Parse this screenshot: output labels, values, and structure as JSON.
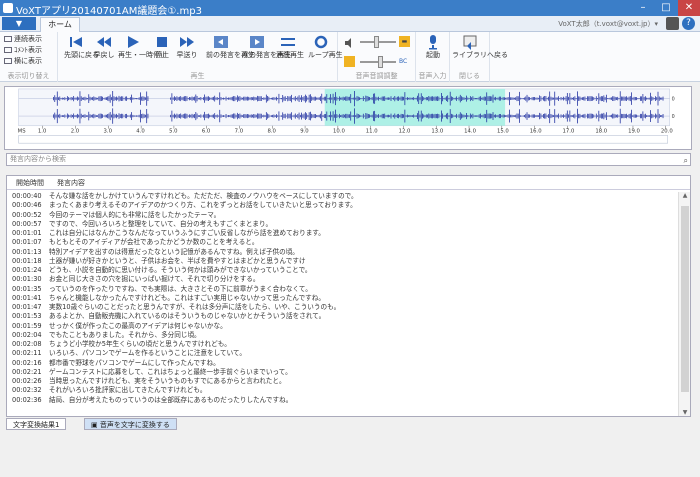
{
  "window": {
    "title": "VoXTアプリ20140701AM議題会①.mp3",
    "minimize": "–",
    "maximize": "□",
    "close": "✕"
  },
  "tabbar": {
    "file_menu": "▼",
    "home_tab": "ホーム",
    "user": "VoXT太郎（t.voxt@voxt.jp）▾"
  },
  "ribbon": {
    "view": {
      "items": [
        "連続表示",
        "ｺﾒﾝﾄ表示",
        "横に表示"
      ],
      "label": "表示切り替え"
    },
    "playback": {
      "buttons": [
        "先頭に戻る",
        "早戻し",
        "再生・一時停止",
        "停止",
        "早送り",
        "前の発言を再生",
        "次の発言を再生",
        "連続再生",
        "ループ再生"
      ],
      "label": "再生"
    },
    "volume": {
      "label": "音声音調調整",
      "slider_top": "▬",
      "slider_bottom": "BC"
    },
    "voice": {
      "button": "起動",
      "label": "音声入力"
    },
    "close": {
      "button": "ライブラリへ戻る",
      "label": "閉じる"
    }
  },
  "waveform": {
    "axis_unit": "MS",
    "ticks": [
      "1.0",
      "2.0",
      "3.0",
      "4.0",
      "5.0",
      "6.0",
      "7.0",
      "8.0",
      "9.0",
      "10.0",
      "11.0",
      "12.0",
      "13.0",
      "14.0",
      "15.0",
      "16.0",
      "17.0",
      "18.0",
      "19.0",
      "20.0"
    ],
    "selection_start_s": 9.6,
    "selection_end_s": 15.1,
    "highlight_color": "#aef0e6",
    "wave_color": "#1f2fa0"
  },
  "search": {
    "placeholder": "発言内容から検索",
    "icon": "search-icon"
  },
  "list": {
    "headers": [
      "開始時間",
      "発言内容"
    ],
    "rows": [
      [
        "00:00:40",
        "そんな嫌な話をかしかけていうんですけれども。ただただ、検査のノウハウをベースにしていますので。"
      ],
      [
        "00:00:46",
        "まったくあまり考えるそのアイデアのかつくり方、これをずっとお話をしていきたいと思っております。"
      ],
      [
        "00:00:52",
        "今回のテーマは個人的にも非常に話をしたかったテーマ。"
      ],
      [
        "00:00:57",
        "ですので、今回いろいろと整理をしていて、自分の考えもすごくまとまり。"
      ],
      [
        "00:01:01",
        "これは自分にはなんかこうなんだなっていうふうにすごい反省しながら話を進めております。"
      ],
      [
        "00:01:07",
        "もともとそのアイディアが会社であったかどうか数のことを考えると。"
      ],
      [
        "00:01:13",
        "特別アイデアを出すのは得意だったなという記憶があるんですね。例えば子供の頃。"
      ],
      [
        "00:01:18",
        "土器が嫌いが好きかというと、子供はお会を、半ばを費やすとはまどかと思うんですけ"
      ],
      [
        "00:01:24",
        "どうも、小説を自動的に思い付ける。そういう何かは頭みができないかっていうことで。"
      ],
      [
        "00:01:30",
        "お金と同じ大きさの穴を掘にいっぱい掘けて、それで切り分けをする。"
      ],
      [
        "00:01:35",
        "っていうのを作ったりですね、でも実際は、大きさとその下に前章がうまく合わなくて。"
      ],
      [
        "00:01:41",
        "ちゃんと機能しなかったんですけれども。これはすごい実用じゃないかって思ったんですね。"
      ],
      [
        "00:01:47",
        "実数10歳ぐらいのことだったと思うんですが、それは多分声に話をしたら、いや、こういうのも。"
      ],
      [
        "00:01:53",
        "あるよとか、自動販売機に入れているのはそういうものじゃないかとかそういう話をされて。"
      ],
      [
        "00:01:59",
        "せっかく僕が作ったこの最高のアイデアは何じゃないかな。"
      ],
      [
        "00:02:04",
        "でもたこともありました。それから、多分同じ頃。"
      ],
      [
        "00:02:08",
        "ちょうど小学校か5年生くらいの頃だと思うんですけれども。"
      ],
      [
        "00:02:11",
        "いろいろ、パソコンでゲームを作るということに注意をしていて。"
      ],
      [
        "00:02:16",
        "都市番で野球をパソコンでゲームにして作ったんですね。"
      ],
      [
        "00:02:21",
        "ゲームコンテストに応募をして、これはちょっと最終一歩手前ぐらいまでいって。"
      ],
      [
        "00:02:26",
        "当時思ったんですけれども、実をそういうものもすでにあるからと言われたと。"
      ],
      [
        "00:02:32",
        "それがいろいろ批評家に出してきたんですけれども。"
      ],
      [
        "00:02:36",
        "結局、自分が考えたものっていうのは全部既存にあるものだったりしたんですね。"
      ]
    ]
  },
  "bottom_tabs": [
    "文字変換結果1",
    "音声を文字に変換する"
  ]
}
